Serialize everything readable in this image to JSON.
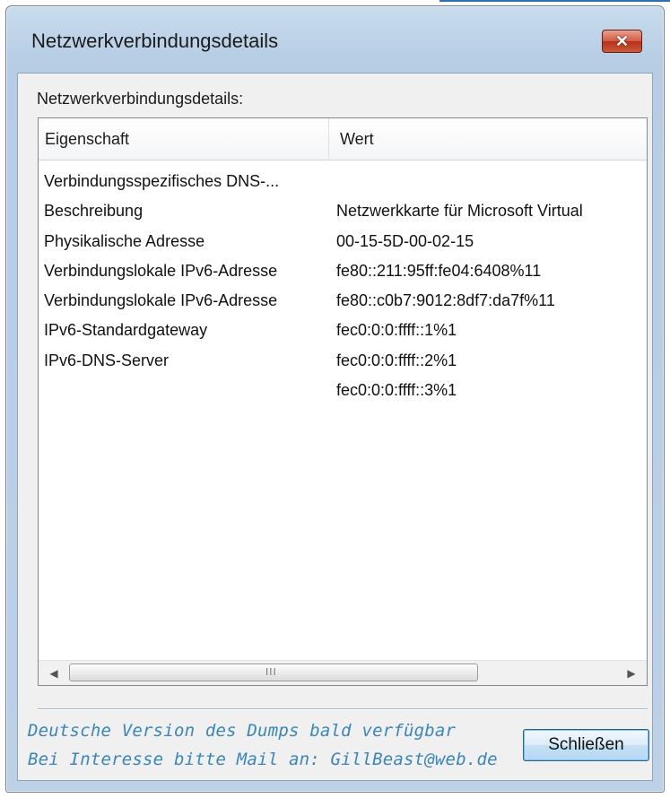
{
  "window": {
    "title": "Netzwerkverbindungsdetails",
    "close_glyph": "✕",
    "close_icon": "close-icon"
  },
  "group_label": "Netzwerkverbindungsdetails:",
  "table": {
    "columns": [
      "Eigenschaft",
      "Wert"
    ],
    "rows": [
      {
        "property": "Verbindungsspezifisches DNS-...",
        "value": ""
      },
      {
        "property": "Beschreibung",
        "value": "Netzwerkkarte für Microsoft Virtual"
      },
      {
        "property": "Physikalische Adresse",
        "value": "00-15-5D-00-02-15"
      },
      {
        "property": "Verbindungslokale IPv6-Adresse",
        "value": "fe80::211:95ff:fe04:6408%11"
      },
      {
        "property": "Verbindungslokale IPv6-Adresse",
        "value": "fe80::c0b7:9012:8df7:da7f%11"
      },
      {
        "property": "IPv6-Standardgateway",
        "value": "fec0:0:0:ffff::1%1"
      },
      {
        "property": "IPv6-DNS-Server",
        "value": "fec0:0:0:ffff::2%1"
      },
      {
        "property": "",
        "value": "fec0:0:0:ffff::3%1"
      }
    ]
  },
  "scrollbar": {
    "left_arrow": "◀",
    "right_arrow": "▶",
    "grip": "III"
  },
  "notes": [
    "Deutsche Version des Dumps bald verfügbar",
    "Bei Interesse bitte Mail an: GillBeast@web.de"
  ],
  "buttons": {
    "close_label": "Schließen"
  },
  "colors": {
    "note_text": "#3a86b8",
    "close_button": "#c8432b"
  }
}
